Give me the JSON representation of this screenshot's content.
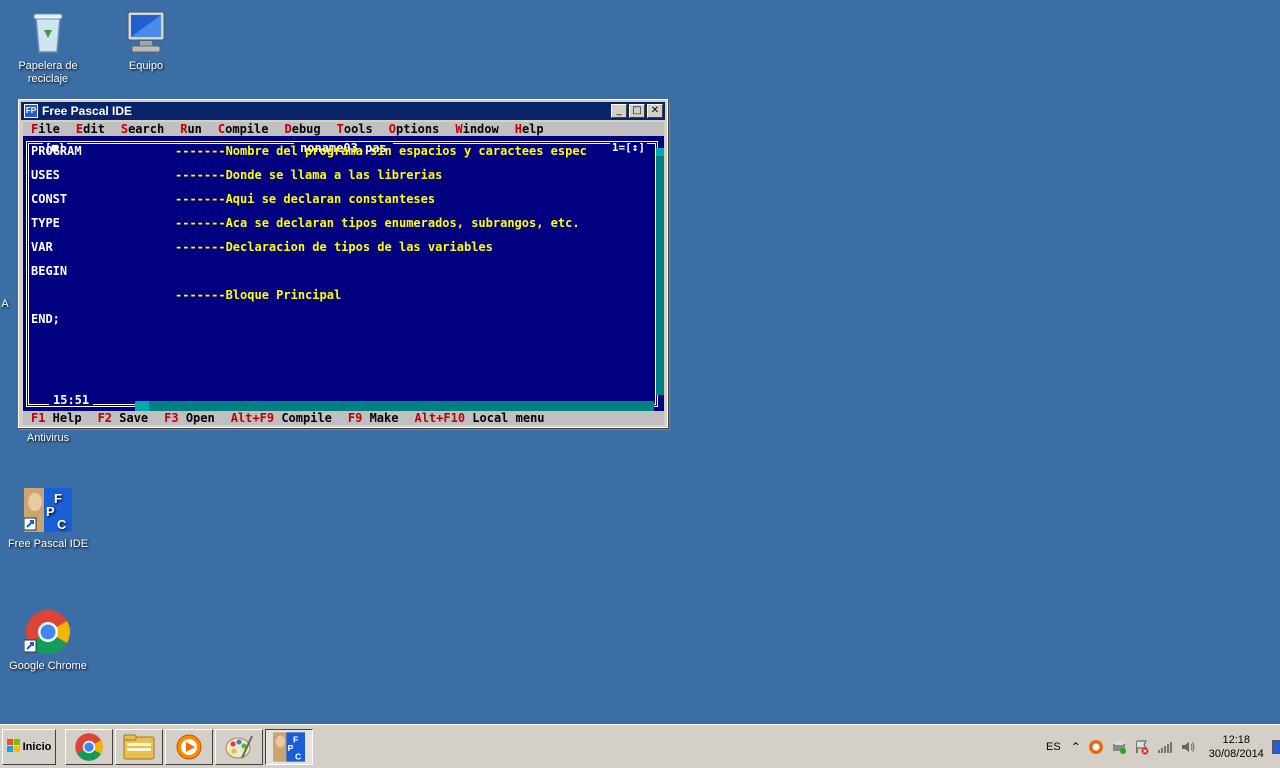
{
  "desktop": {
    "icons": [
      {
        "label": "Papelera de reciclaje"
      },
      {
        "label": "Equipo"
      },
      {
        "label": "Antivirus"
      },
      {
        "label": "Free Pascal IDE"
      },
      {
        "label": "Google Chrome"
      }
    ],
    "partial_label": "A"
  },
  "window": {
    "title": "Free Pascal IDE",
    "controls": {
      "minimize": "_",
      "maximize": "□",
      "close": "✕"
    }
  },
  "menu": [
    {
      "hot": "F",
      "rest": "ile"
    },
    {
      "hot": "E",
      "rest": "dit"
    },
    {
      "hot": "S",
      "rest": "earch"
    },
    {
      "hot": "R",
      "rest": "un"
    },
    {
      "hot": "C",
      "rest": "ompile"
    },
    {
      "hot": "D",
      "rest": "ebug"
    },
    {
      "hot": "T",
      "rest": "ools"
    },
    {
      "hot": "O",
      "rest": "ptions"
    },
    {
      "hot": "W",
      "rest": "indow"
    },
    {
      "hot": "H",
      "rest": "elp"
    }
  ],
  "editor": {
    "filename": "noname03.pas",
    "close_box": "[■]",
    "window_number": "1=[↕]",
    "cursor_position": "15:51",
    "lines": [
      {
        "kw": "PROGRAM",
        "cm": "-------Nombre del programa sin espacios y caractees espec"
      },
      {
        "kw": "USES",
        "cm": "-------Donde se llama a las librerias"
      },
      {
        "kw": "CONST",
        "cm": "-------Aqui se declaran constanteses"
      },
      {
        "kw": "TYPE",
        "cm": "-------Aca se declaran tipos enumerados, subrangos, etc."
      },
      {
        "kw": "VAR",
        "cm": "-------Declaracion de tipos de las variables"
      },
      {
        "kw": "BEGIN",
        "cm": ""
      },
      {
        "kw": "",
        "cm": "-------Bloque Principal"
      },
      {
        "kw": "END;",
        "cm": ""
      }
    ]
  },
  "status": [
    {
      "key": "F1",
      "text": " Help"
    },
    {
      "key": "F2",
      "text": " Save"
    },
    {
      "key": "F3",
      "text": " Open"
    },
    {
      "key": "Alt+F9",
      "text": " Compile"
    },
    {
      "key": "F9",
      "text": " Make"
    },
    {
      "key": "Alt+F10",
      "text": " Local menu"
    }
  ],
  "taskbar": {
    "start_label": "Inicio",
    "language": "ES",
    "time": "12:18",
    "date": "30/08/2014"
  }
}
